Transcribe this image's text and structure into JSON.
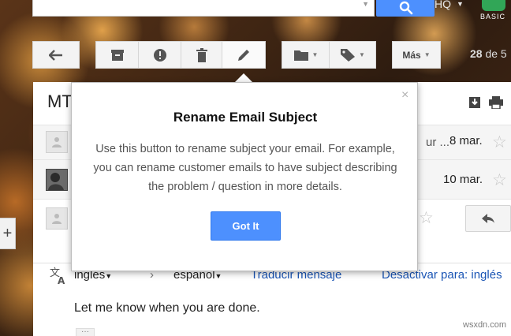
{
  "header": {
    "account_label": "HQ",
    "badge_label": "BASIC",
    "colors": {
      "search_button": "#4d90fe",
      "badge": "#31a657"
    }
  },
  "toolbar": {
    "more_label": "Más",
    "count_number": "28",
    "count_suffix": "de 5",
    "icons": [
      "back-arrow-icon",
      "archive-icon",
      "spam-icon",
      "trash-icon",
      "pencil-icon",
      "folder-icon",
      "label-tag-icon"
    ]
  },
  "thread": {
    "subject_prefix": "MT",
    "messages": [
      {
        "snippet": "ur ...",
        "date": "8 mar."
      },
      {
        "date": "10 mar."
      }
    ],
    "translate_bar": {
      "source_language": "inglés",
      "target_language": "español",
      "translate_link": "Traducir mensaje",
      "disable_link": "Desactivar para: inglés"
    },
    "body": "Let me know when you are done."
  },
  "popup": {
    "title": "Rename Email Subject",
    "body": "Use this button to rename subject your email. For example, you can rename customer emails to have subject describing the problem / question in more details.",
    "button_label": "Got It",
    "close_glyph": "×",
    "colors": {
      "button": "#4d90fe"
    }
  },
  "watermark": "wsxdn.com"
}
